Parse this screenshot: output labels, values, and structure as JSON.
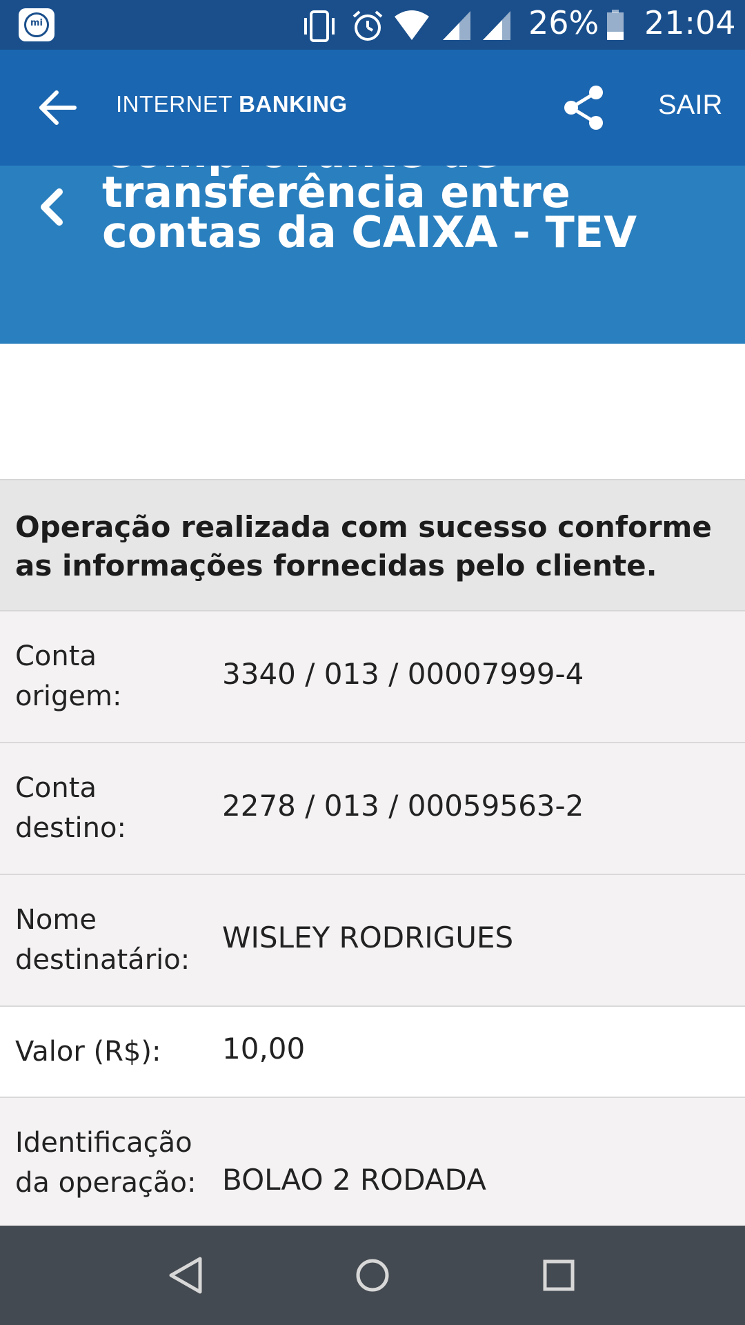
{
  "status_bar": {
    "battery_percent": "26%",
    "time": "21:04",
    "icons": [
      "mi-app-icon",
      "vibrate-icon",
      "alarm-icon",
      "wifi-icon",
      "signal-icon",
      "signal-icon",
      "battery-icon"
    ]
  },
  "app_bar": {
    "brand_light": "INTERNET ",
    "brand_bold": "BANKING",
    "sair_label": "SAIR"
  },
  "page": {
    "title_partial": "Comprovante de",
    "title_line1": "transferência entre",
    "title_line2": "contas da CAIXA - TEV"
  },
  "message": "Operação realizada com sucesso conforme as informações fornecidas pelo cliente.",
  "details": [
    {
      "label": "Conta origem:",
      "value": "3340 / 013 / 00007999-4"
    },
    {
      "label": "Conta destino:",
      "value": "2278 / 013 / 00059563-2"
    },
    {
      "label": "Nome destinatário:",
      "value": "WISLEY RODRIGUES"
    },
    {
      "label": "Valor (R$):",
      "value": "10,00"
    },
    {
      "label": "Identificação da operação:",
      "value": "BOLAO 2 RODADA"
    }
  ],
  "colors": {
    "status_bar": "#1a4f8c",
    "app_bar": "#1b66b0",
    "title_band": "#2a80bf",
    "message_bg": "#e6e6e6",
    "nav_bar": "#444a51"
  }
}
